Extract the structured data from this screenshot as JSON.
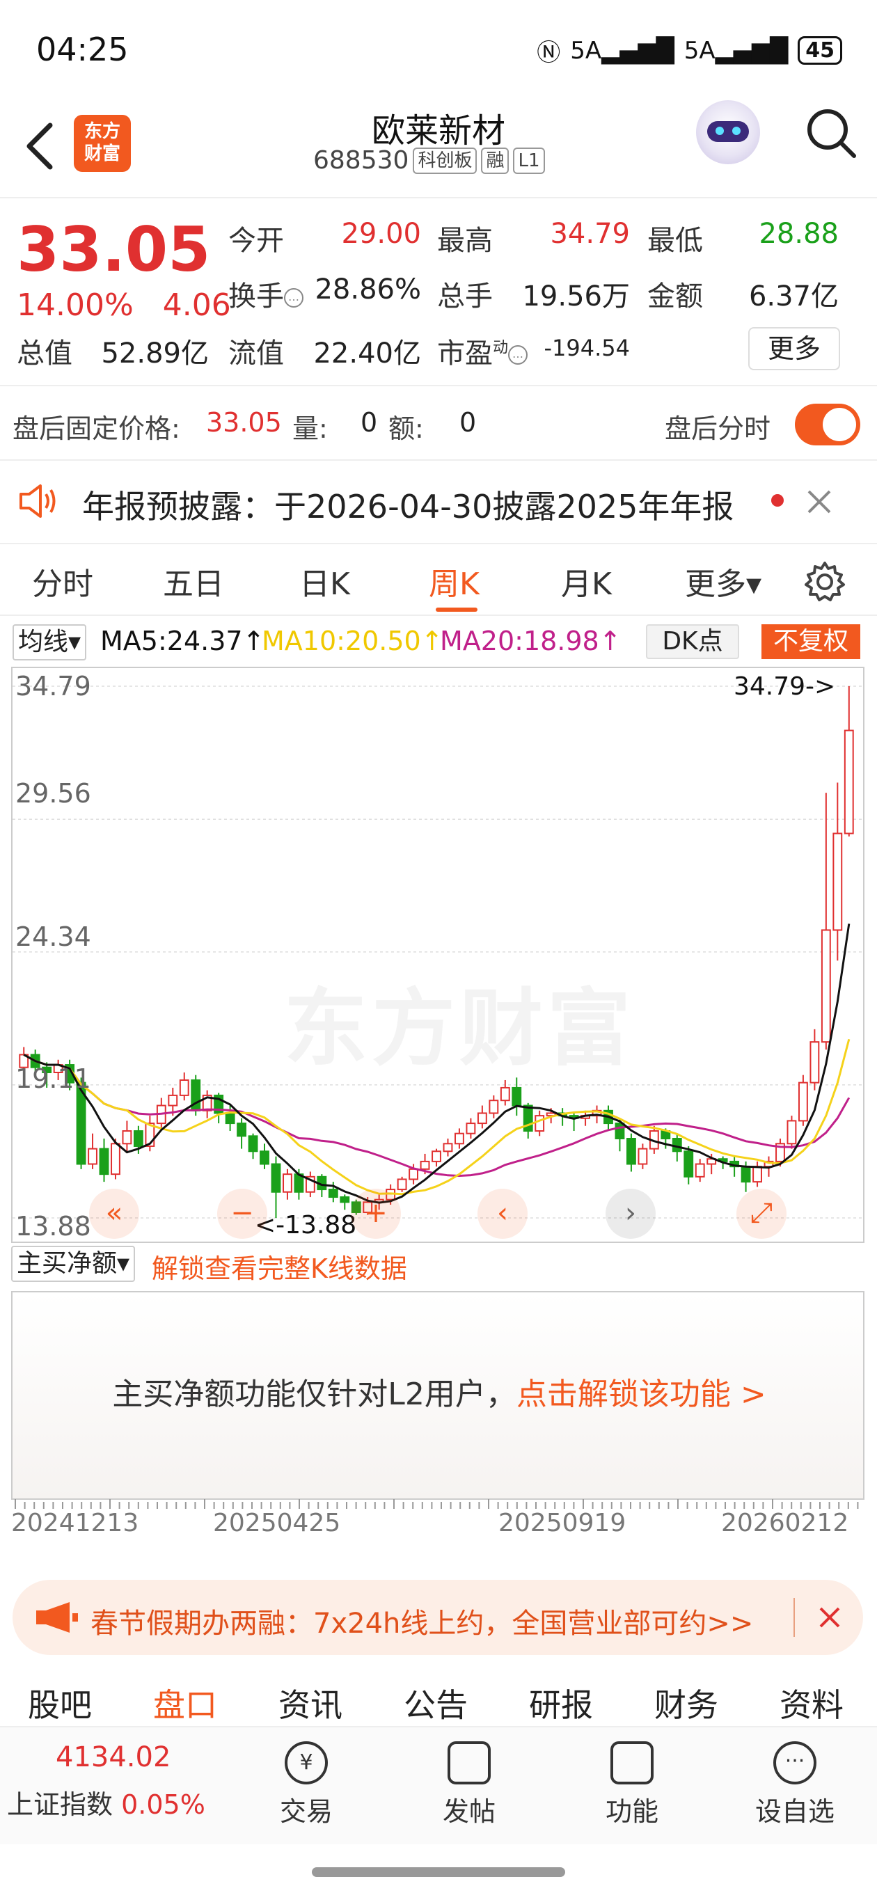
{
  "status_bar": {
    "time": "04:25",
    "signal1": "5A",
    "signal2": "5A",
    "battery": "45"
  },
  "header": {
    "stock_name": "欧莱新材",
    "stock_code": "688530",
    "board_tag": "科创板",
    "margin_tag": "融",
    "level_tag": "L1",
    "logo_line1": "东方",
    "logo_line2": "财富"
  },
  "quote": {
    "price": "33.05",
    "change_pct": "14.00%",
    "change_amt": "4.06",
    "open_label": "今开",
    "open": "29.00",
    "high_label": "最高",
    "high": "34.79",
    "low_label": "最低",
    "low": "28.88",
    "turnover_label": "换手",
    "turnover": "28.86%",
    "volume_label": "总手",
    "volume": "19.56万",
    "amount_label": "金额",
    "amount": "6.37亿",
    "mktcap_label": "总值",
    "mktcap": "52.89亿",
    "float_label": "流值",
    "float_cap": "22.40亿",
    "pe_label": "市盈",
    "pe_sup": "动",
    "pe": "-194.54",
    "more_label": "更多"
  },
  "after_hours": {
    "price_label": "盘后固定价格:",
    "price": "33.05",
    "vol_label": "量:",
    "vol": "0",
    "amt_label": "额:",
    "amt": "0",
    "toggle_label": "盘后分时"
  },
  "notice": {
    "text": "年报预披露：于2026-04-30披露2025年年报"
  },
  "chart_tabs": {
    "items": [
      "分时",
      "五日",
      "日K",
      "周K",
      "月K",
      "更多▾"
    ],
    "active": "周K"
  },
  "ma_legend": {
    "selector": "均线",
    "ma5": "MA5:24.37↑",
    "ma10": "MA10:20.50↑",
    "ma20": "MA20:18.98↑",
    "dk_label": "DK点",
    "fq_label": "不复权",
    "ma5_color": "#111111",
    "ma10_color": "#f5d21a",
    "ma20_color": "#c0208a"
  },
  "chart_data": {
    "type": "candlestick",
    "y_ticks": [
      "34.79",
      "29.56",
      "24.34",
      "19.11",
      "13.88"
    ],
    "ylim": [
      13.88,
      34.79
    ],
    "max_label": "34.79->",
    "min_label": "<-13.88",
    "watermark": "东方财富",
    "up_color": "#e03030",
    "down_color": "#1aa01a",
    "candles": [
      [
        19.8,
        20.3,
        19.0,
        20.6
      ],
      [
        20.3,
        19.8,
        19.6,
        20.5
      ],
      [
        19.8,
        19.6,
        19.0,
        20.0
      ],
      [
        19.6,
        19.9,
        19.3,
        20.1
      ],
      [
        19.9,
        19.2,
        18.9,
        20.1
      ],
      [
        19.2,
        16.0,
        15.8,
        19.4
      ],
      [
        16.0,
        16.6,
        15.8,
        17.2
      ],
      [
        16.6,
        15.6,
        15.3,
        17.0
      ],
      [
        15.6,
        16.8,
        15.4,
        17.0
      ],
      [
        16.8,
        17.3,
        16.5,
        17.7
      ],
      [
        17.3,
        16.7,
        16.4,
        17.5
      ],
      [
        16.7,
        17.6,
        16.5,
        17.9
      ],
      [
        17.6,
        18.3,
        17.4,
        18.6
      ],
      [
        18.3,
        18.7,
        17.9,
        19.0
      ],
      [
        18.7,
        19.3,
        18.5,
        19.6
      ],
      [
        19.3,
        18.1,
        17.9,
        19.5
      ],
      [
        18.1,
        18.7,
        17.8,
        18.9
      ],
      [
        18.7,
        18.0,
        17.6,
        18.8
      ],
      [
        18.0,
        17.6,
        17.3,
        18.3
      ],
      [
        17.6,
        17.1,
        16.6,
        17.8
      ],
      [
        17.1,
        16.5,
        16.2,
        17.2
      ],
      [
        16.5,
        16.0,
        15.8,
        16.8
      ],
      [
        16.0,
        14.9,
        13.88,
        16.3
      ],
      [
        14.9,
        15.6,
        14.6,
        15.8
      ],
      [
        15.6,
        14.9,
        14.6,
        15.8
      ],
      [
        14.9,
        15.5,
        14.7,
        15.7
      ],
      [
        15.5,
        15.0,
        14.7,
        15.6
      ],
      [
        15.0,
        14.7,
        14.5,
        15.3
      ],
      [
        14.7,
        14.5,
        14.2,
        14.8
      ],
      [
        14.5,
        14.1,
        14.0,
        14.6
      ],
      [
        14.1,
        14.5,
        14.0,
        14.7
      ],
      [
        14.5,
        14.6,
        14.2,
        14.8
      ],
      [
        14.6,
        15.0,
        14.4,
        15.2
      ],
      [
        15.0,
        15.4,
        14.9,
        15.5
      ],
      [
        15.4,
        15.8,
        15.2,
        16.0
      ],
      [
        15.8,
        16.1,
        15.6,
        16.4
      ],
      [
        16.1,
        16.5,
        15.9,
        16.6
      ],
      [
        16.5,
        16.8,
        16.3,
        17.0
      ],
      [
        16.8,
        17.2,
        16.6,
        17.4
      ],
      [
        17.2,
        17.6,
        17.0,
        17.8
      ],
      [
        17.6,
        18.0,
        17.4,
        18.3
      ],
      [
        18.0,
        18.5,
        17.8,
        18.7
      ],
      [
        18.5,
        19.0,
        18.3,
        19.3
      ],
      [
        19.0,
        18.3,
        17.9,
        19.4
      ],
      [
        18.3,
        17.3,
        17.0,
        18.4
      ],
      [
        17.3,
        17.9,
        17.1,
        18.1
      ],
      [
        17.9,
        18.0,
        17.6,
        18.2
      ],
      [
        18.0,
        17.9,
        17.5,
        18.2
      ],
      [
        17.9,
        17.8,
        17.3,
        18.0
      ],
      [
        17.8,
        17.9,
        17.5,
        18.1
      ],
      [
        17.9,
        18.1,
        17.6,
        18.3
      ],
      [
        18.1,
        17.6,
        17.3,
        18.3
      ],
      [
        17.6,
        17.0,
        16.5,
        17.8
      ],
      [
        17.0,
        16.0,
        15.7,
        17.2
      ],
      [
        16.0,
        16.6,
        15.8,
        16.8
      ],
      [
        16.6,
        17.3,
        16.4,
        17.5
      ],
      [
        17.3,
        17.0,
        16.6,
        17.4
      ],
      [
        17.0,
        16.5,
        16.1,
        17.2
      ],
      [
        16.5,
        15.5,
        15.2,
        16.7
      ],
      [
        15.5,
        16.0,
        15.3,
        16.2
      ],
      [
        16.0,
        16.2,
        15.6,
        16.4
      ],
      [
        16.2,
        16.1,
        15.8,
        16.3
      ],
      [
        16.1,
        15.9,
        15.5,
        16.3
      ],
      [
        15.9,
        15.3,
        14.9,
        16.1
      ],
      [
        15.3,
        15.9,
        15.1,
        16.1
      ],
      [
        15.9,
        16.1,
        15.5,
        16.3
      ],
      [
        16.1,
        16.8,
        15.9,
        17.0
      ],
      [
        16.8,
        17.7,
        16.6,
        17.9
      ],
      [
        17.7,
        19.2,
        17.5,
        19.5
      ],
      [
        19.2,
        20.8,
        18.9,
        21.3
      ],
      [
        20.8,
        25.2,
        20.5,
        30.6
      ],
      [
        25.2,
        29.0,
        24.0,
        31.0
      ],
      [
        29.0,
        33.05,
        28.88,
        34.79
      ]
    ]
  },
  "netbuy": {
    "selector": "主买净额",
    "unlock_link": "解锁查看完整K线数据",
    "lock_text": "主买净额功能仅针对L2用户，",
    "lock_link": "点击解锁该功能 >"
  },
  "x_labels": [
    "20241213",
    "20250425",
    "20250919",
    "20260212"
  ],
  "banner": {
    "text": "春节假期办两融：7x24h线上约，全国营业部可约>>"
  },
  "sub_tabs": {
    "items": [
      "股吧",
      "盘口",
      "资讯",
      "公告",
      "研报",
      "财务",
      "资料"
    ],
    "active": "盘口"
  },
  "bottom_nav": {
    "index_value": "4134.02",
    "index_name": "上证指数",
    "index_change": "0.05%",
    "trade": "交易",
    "post": "发帖",
    "func": "功能",
    "watch": "设自选"
  }
}
